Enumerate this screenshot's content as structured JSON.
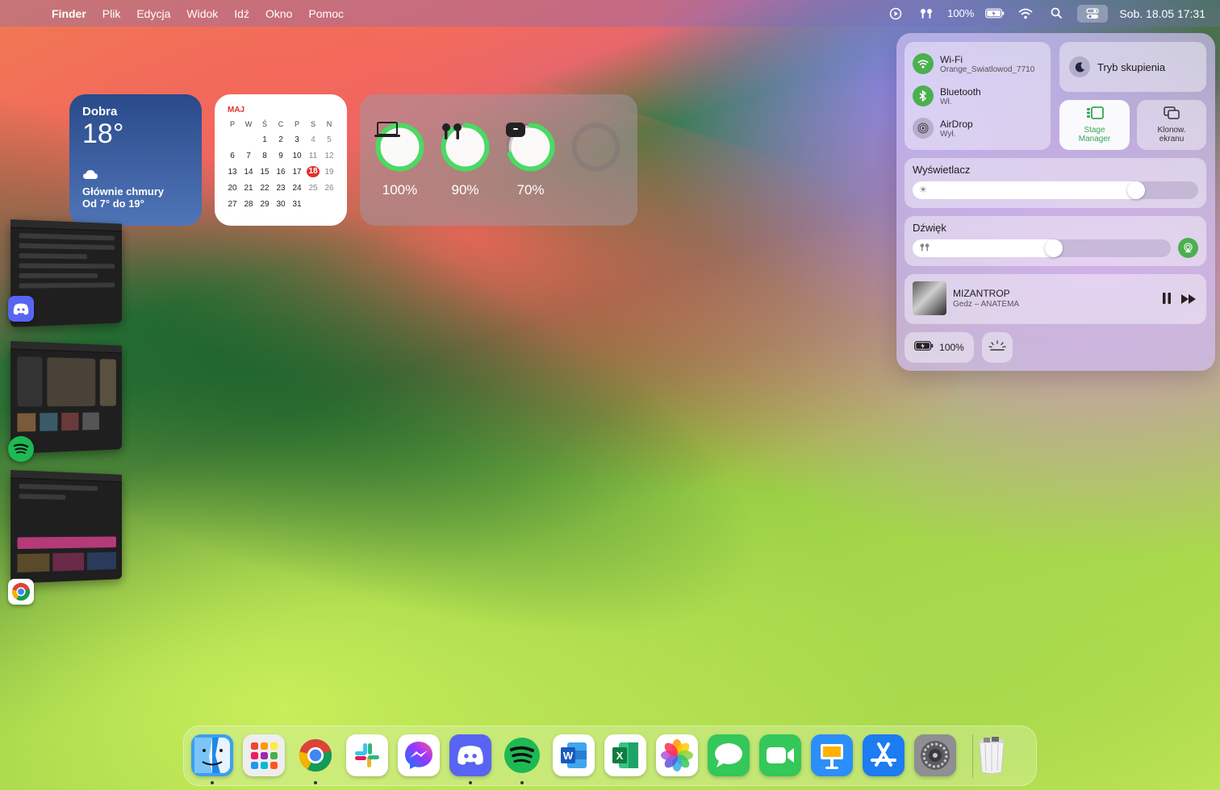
{
  "menubar": {
    "apple": "",
    "items": [
      "Finder",
      "Plik",
      "Edycja",
      "Widok",
      "Idź",
      "Okno",
      "Pomoc"
    ],
    "battery_pct": "100%",
    "datetime": "Sob. 18.05  17:31",
    "icons": [
      "play-circle-icon",
      "airpods-icon",
      "battery-icon",
      "wifi-icon",
      "search-icon",
      "control-center-icon"
    ]
  },
  "weather": {
    "city": "Dobra",
    "temp": "18°",
    "condition": "Głównie chmury",
    "range": "Od 7° do 19°"
  },
  "calendar": {
    "month": "MAJ",
    "headers": [
      "P",
      "W",
      "Ś",
      "C",
      "P",
      "S",
      "N"
    ],
    "today": "18",
    "days": [
      "",
      "",
      "1",
      "2",
      "3",
      "4",
      "5",
      "6",
      "7",
      "8",
      "9",
      "10",
      "11",
      "12",
      "13",
      "14",
      "15",
      "16",
      "17",
      "18",
      "19",
      "20",
      "21",
      "22",
      "23",
      "24",
      "25",
      "26",
      "27",
      "28",
      "29",
      "30",
      "31",
      "",
      ""
    ]
  },
  "batteries": {
    "items": [
      {
        "device": "laptop-icon",
        "pct": "100%",
        "level": 1.0
      },
      {
        "device": "airpods-icon",
        "pct": "90%",
        "level": 0.9
      },
      {
        "device": "airpods-case-icon",
        "pct": "70%",
        "level": 0.7
      },
      {
        "device": "empty-slot",
        "pct": "",
        "level": 0
      }
    ],
    "ring_color": "#4cd964"
  },
  "stage_manager": {
    "apps": [
      "Discord",
      "Spotify",
      "Chrome"
    ]
  },
  "control_center": {
    "wifi": {
      "title": "Wi-Fi",
      "sub": "Orange_Swiatlowod_7710"
    },
    "bluetooth": {
      "title": "Bluetooth",
      "sub": "Wł."
    },
    "airdrop": {
      "title": "AirDrop",
      "sub": "Wył."
    },
    "focus": "Tryb skupienia",
    "stage_manager": "Stage Manager",
    "screen_mirror": "Klonow. ekranu",
    "display": {
      "label": "Wyświetlacz",
      "level": 0.8
    },
    "sound": {
      "label": "Dźwięk",
      "level": 0.55
    },
    "now_playing": {
      "title": "MIZANTROP",
      "artist": "Gedz – ANATEMA"
    },
    "battery": "100%"
  },
  "dock": {
    "apps": [
      {
        "name": "Finder",
        "icon": "finder-icon",
        "color": "#3aa0f0",
        "running": true
      },
      {
        "name": "Launchpad",
        "icon": "launchpad-icon",
        "color": "#eeeeee",
        "running": false
      },
      {
        "name": "Chrome",
        "icon": "chrome-icon",
        "color": "#ffffff",
        "running": true
      },
      {
        "name": "Slack",
        "icon": "slack-icon",
        "color": "#ffffff",
        "running": false
      },
      {
        "name": "Messenger",
        "icon": "messenger-icon",
        "color": "#ffffff",
        "running": false
      },
      {
        "name": "Discord",
        "icon": "discord-icon",
        "color": "#5865f2",
        "running": true
      },
      {
        "name": "Spotify",
        "icon": "spotify-icon",
        "color": "#1db954",
        "running": true
      },
      {
        "name": "Word",
        "icon": "word-icon",
        "color": "#ffffff",
        "running": false
      },
      {
        "name": "Excel",
        "icon": "excel-icon",
        "color": "#ffffff",
        "running": false
      },
      {
        "name": "Photos",
        "icon": "photos-icon",
        "color": "#ffffff",
        "running": false
      },
      {
        "name": "Messages",
        "icon": "messages-icon",
        "color": "#34c759",
        "running": false
      },
      {
        "name": "FaceTime",
        "icon": "facetime-icon",
        "color": "#34c759",
        "running": false
      },
      {
        "name": "Keynote",
        "icon": "keynote-icon",
        "color": "#2c8ef8",
        "running": false
      },
      {
        "name": "App Store",
        "icon": "app-store-icon",
        "color": "#1d7cf2",
        "running": false
      },
      {
        "name": "System Settings",
        "icon": "settings-icon",
        "color": "#8e8e93",
        "running": false
      },
      {
        "name": "Trash",
        "icon": "trash-icon",
        "color": "#e9e9ee",
        "running": false
      }
    ]
  }
}
